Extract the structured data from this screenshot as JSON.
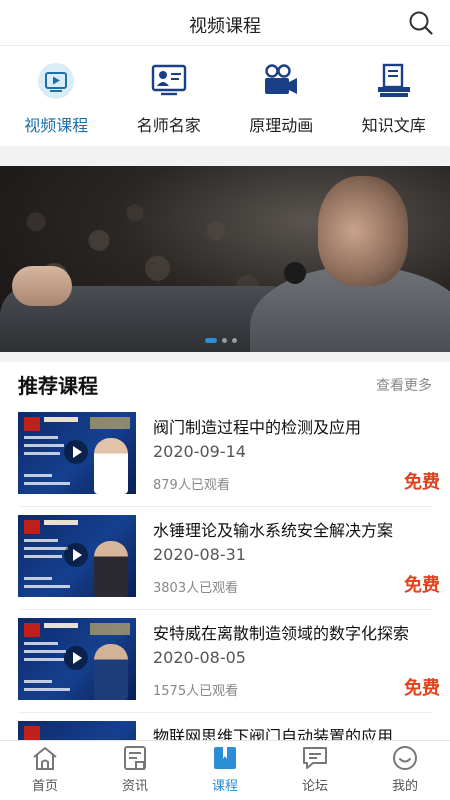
{
  "header": {
    "title": "视频课程",
    "search_icon": "search-icon"
  },
  "categories": [
    {
      "label": "视频课程",
      "icon": "video-play-icon",
      "active": true
    },
    {
      "label": "名师名家",
      "icon": "teacher-board-icon",
      "active": false
    },
    {
      "label": "原理动画",
      "icon": "video-camera-icon",
      "active": false
    },
    {
      "label": "知识文库",
      "icon": "book-stack-icon",
      "active": false
    }
  ],
  "banner": {
    "dots": 3,
    "active_dot": 0
  },
  "section": {
    "title": "推荐课程",
    "more_label": "查看更多"
  },
  "courses": [
    {
      "title": "阀门制造过程中的检测及应用",
      "date": "2020-09-14",
      "views": "879人已观看",
      "price": "免费"
    },
    {
      "title": "水锤理论及输水系统安全解决方案",
      "date": "2020-08-31",
      "views": "3803人已观看",
      "price": "免费"
    },
    {
      "title": "安特威在离散制造领域的数字化探索",
      "date": "2020-08-05",
      "views": "1575人已观看",
      "price": "免费"
    },
    {
      "title": "物联网思维下阀门自动装置的应用",
      "date": "",
      "views": "",
      "price": ""
    }
  ],
  "tabbar": [
    {
      "label": "首页",
      "icon": "home-icon",
      "active": false
    },
    {
      "label": "资讯",
      "icon": "news-icon",
      "active": false
    },
    {
      "label": "课程",
      "icon": "course-book-icon",
      "active": true
    },
    {
      "label": "论坛",
      "icon": "forum-chat-icon",
      "active": false
    },
    {
      "label": "我的",
      "icon": "profile-smile-icon",
      "active": false
    }
  ],
  "colors": {
    "accent": "#1d6fa8",
    "tab_active": "#2b8fd6",
    "price": "#e0421b"
  }
}
